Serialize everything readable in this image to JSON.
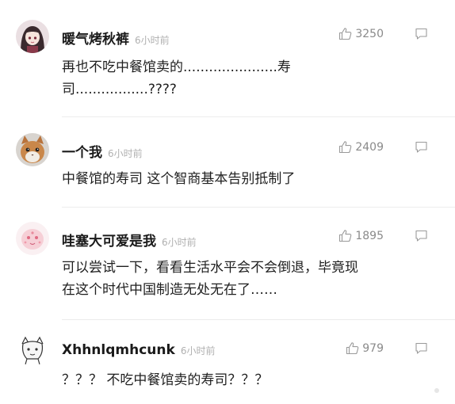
{
  "comments": [
    {
      "username": "暖气烤秋裤",
      "time": "6小时前",
      "likes": "3250",
      "text_line1": "再也不吃中餐馆卖的......................寿",
      "text_line2": "司.................????",
      "avatar_icon": "anime-girl-avatar-icon"
    },
    {
      "username": "一个我",
      "time": "6小时前",
      "likes": "2409",
      "text_line1": "中餐馆的寿司 这个智商基本告别抵制了",
      "avatar_icon": "cat-avatar-icon"
    },
    {
      "username": "哇塞大可爱是我",
      "time": "6小时前",
      "likes": "1895",
      "text_line1": "可以尝试一下，看看生活水平会不会倒退，毕竟现",
      "text_line2": "在这个时代中国制造无处无在了……",
      "avatar_icon": "pink-blob-avatar-icon"
    },
    {
      "username": "Xhhnlqmhcunk",
      "time": "6小时前",
      "likes": "979",
      "text_line1": "？？？ 不吃中餐馆卖的寿司？？？",
      "avatar_icon": "sketch-cat-avatar-icon"
    }
  ],
  "colors": {
    "username": "#1a1a1a",
    "meta": "#b0b0b0",
    "like": "#8a8a8a",
    "divider": "#ececec"
  }
}
